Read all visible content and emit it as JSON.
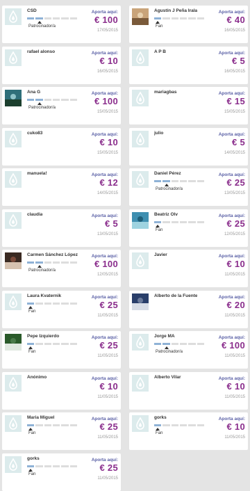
{
  "labels": {
    "aporta": "Aporta aquí:"
  },
  "colors": {
    "page_bg": "#e4e4e4",
    "card_bg": "#ffffff",
    "amount": "#8a2d8c",
    "aporta": "#5b61a6",
    "segment_filled": "#8fb2d6",
    "segment_empty": "#dddddd",
    "avatar_placeholder_bg": "#dcebec"
  },
  "backers": [
    {
      "name": "CSD",
      "level": "Patrocinador/a",
      "level_step": 2,
      "amount": "€ 100",
      "date": "17/05/2015",
      "avatar": "default"
    },
    {
      "name": "Agustín J Peña Irala",
      "level": "Fan",
      "level_step": 1,
      "amount": "€ 40",
      "date": "16/05/2015",
      "avatar": "photo"
    },
    {
      "name": "rafael alonso",
      "level": "",
      "level_step": 0,
      "amount": "€ 10",
      "date": "16/05/2015",
      "avatar": "default"
    },
    {
      "name": "A P B",
      "level": "",
      "level_step": 0,
      "amount": "€ 5",
      "date": "16/05/2015",
      "avatar": "default"
    },
    {
      "name": "Ana G",
      "level": "Patrocinador/a",
      "level_step": 2,
      "amount": "€ 100",
      "date": "15/05/2015",
      "avatar": "photo"
    },
    {
      "name": "mariagbas",
      "level": "",
      "level_step": 0,
      "amount": "€ 15",
      "date": "15/05/2015",
      "avatar": "default"
    },
    {
      "name": "cuko83",
      "level": "",
      "level_step": 0,
      "amount": "€ 10",
      "date": "15/05/2015",
      "avatar": "default"
    },
    {
      "name": "julio",
      "level": "",
      "level_step": 0,
      "amount": "€ 5",
      "date": "14/05/2015",
      "avatar": "default"
    },
    {
      "name": "manuela!",
      "level": "",
      "level_step": 0,
      "amount": "€ 12",
      "date": "14/05/2015",
      "avatar": "default"
    },
    {
      "name": "Daniel Pérez",
      "level": "Patrocinador/a",
      "level_step": 2,
      "amount": "€ 25",
      "date": "13/05/2015",
      "avatar": "default"
    },
    {
      "name": "claudia",
      "level": "",
      "level_step": 0,
      "amount": "€ 5",
      "date": "13/05/2015",
      "avatar": "default"
    },
    {
      "name": "Beatriz Olv",
      "level": "Fan",
      "level_step": 1,
      "amount": "€ 25",
      "date": "12/05/2015",
      "avatar": "photo"
    },
    {
      "name": "Carmen Sánchez López",
      "level": "Patrocinador/a",
      "level_step": 2,
      "amount": "€ 100",
      "date": "12/05/2015",
      "avatar": "photo"
    },
    {
      "name": "Javier",
      "level": "",
      "level_step": 0,
      "amount": "€ 10",
      "date": "11/05/2015",
      "avatar": "default"
    },
    {
      "name": "Laura Kvaternik",
      "level": "Fan",
      "level_step": 1,
      "amount": "€ 25",
      "date": "11/05/2015",
      "avatar": "default"
    },
    {
      "name": "Alberto de la Fuente",
      "level": "",
      "level_step": 0,
      "amount": "€ 20",
      "date": "11/05/2015",
      "avatar": "photo"
    },
    {
      "name": "Pepe Izquierdo",
      "level": "Fan",
      "level_step": 1,
      "amount": "€ 25",
      "date": "11/05/2015",
      "avatar": "photo"
    },
    {
      "name": "Jorge MA",
      "level": "Patrocinador/a",
      "level_step": 2,
      "amount": "€ 100",
      "date": "11/05/2015",
      "avatar": "default"
    },
    {
      "name": "Anónimo",
      "level": "",
      "level_step": 0,
      "amount": "€ 10",
      "date": "11/05/2015",
      "avatar": "default"
    },
    {
      "name": "Alberto Vilar",
      "level": "",
      "level_step": 0,
      "amount": "€ 10",
      "date": "11/05/2015",
      "avatar": "default"
    },
    {
      "name": "Maria Miguel",
      "level": "Fan",
      "level_step": 1,
      "amount": "€ 25",
      "date": "11/05/2015",
      "avatar": "default"
    },
    {
      "name": "gorks",
      "level": "Fan",
      "level_step": 1,
      "amount": "€ 10",
      "date": "11/05/2015",
      "avatar": "default"
    },
    {
      "name": "gorks",
      "level": "Fan",
      "level_step": 1,
      "amount": "€ 25",
      "date": "11/05/2015",
      "avatar": "default"
    }
  ]
}
